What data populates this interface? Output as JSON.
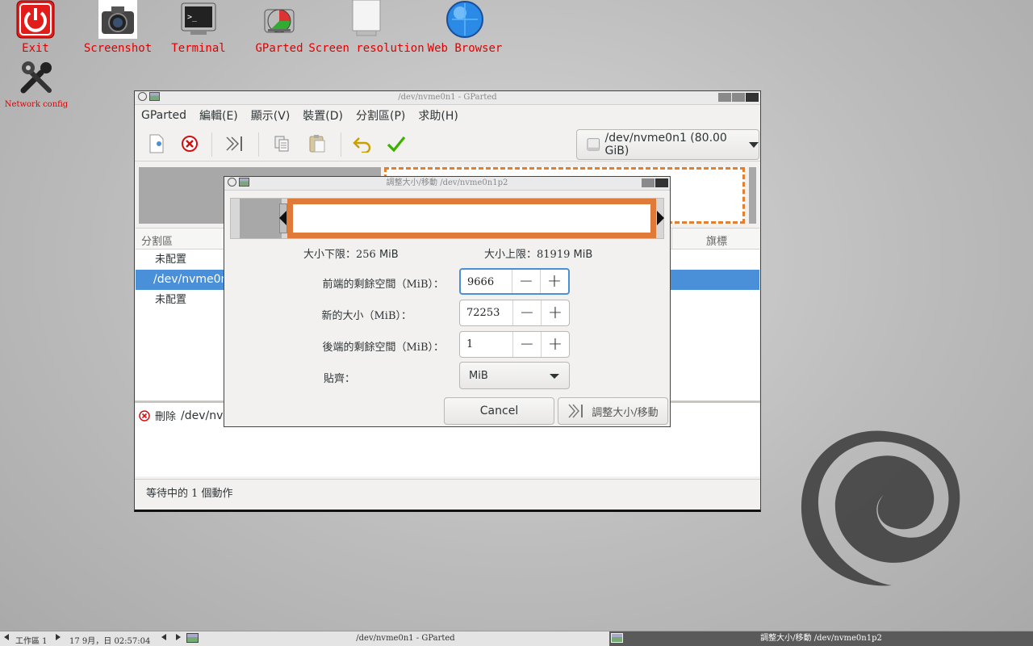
{
  "desktop_icons": [
    {
      "label": "Exit"
    },
    {
      "label": "Screenshot"
    },
    {
      "label": "Terminal"
    },
    {
      "label": "GParted"
    },
    {
      "label": "Screen resolution"
    },
    {
      "label": "Web Browser"
    },
    {
      "label": "Network config"
    }
  ],
  "main_window": {
    "title": "/dev/nvme0n1 - GParted",
    "menu": [
      "GParted",
      "編輯(E)",
      "顯示(V)",
      "裝置(D)",
      "分割區(P)",
      "求助(H)"
    ],
    "device_selector": "/dev/nvme0n1 (80.00 GiB)",
    "columns": {
      "partition": "分割區",
      "flags": "旗標"
    },
    "rows": [
      {
        "name": "未配置",
        "selected": false
      },
      {
        "name": "/dev/nvme0n1",
        "selected": true
      },
      {
        "name": "未配置",
        "selected": false
      }
    ],
    "pending_op": {
      "verb": "刪除",
      "target": "/dev/nvm"
    },
    "status": "等待中的 1 個動作"
  },
  "dialog": {
    "title": "調整大小/移動 /dev/nvme0n1p2",
    "min_size_label": "大小下限：256",
    "max_size_label": "大小上限：81919",
    "unit": "MiB",
    "fields": [
      {
        "label": "前端的剩餘空間（MiB）：",
        "value": "9666"
      },
      {
        "label": "新的大小（MiB）：",
        "value": "72253"
      },
      {
        "label": "後端的剩餘空間（MiB）：",
        "value": "1"
      }
    ],
    "align_label": "貼齊：",
    "align_value": "MiB",
    "cancel_label": "Cancel",
    "apply_label": "調整大小/移動"
  },
  "taskbar": {
    "workspace": "工作區 1",
    "datetime": "17  9月，日 02:57:04",
    "task1": "/dev/nvme0n1 - GParted",
    "task2": "調整大小/移動 /dev/nvme0n1p2"
  }
}
